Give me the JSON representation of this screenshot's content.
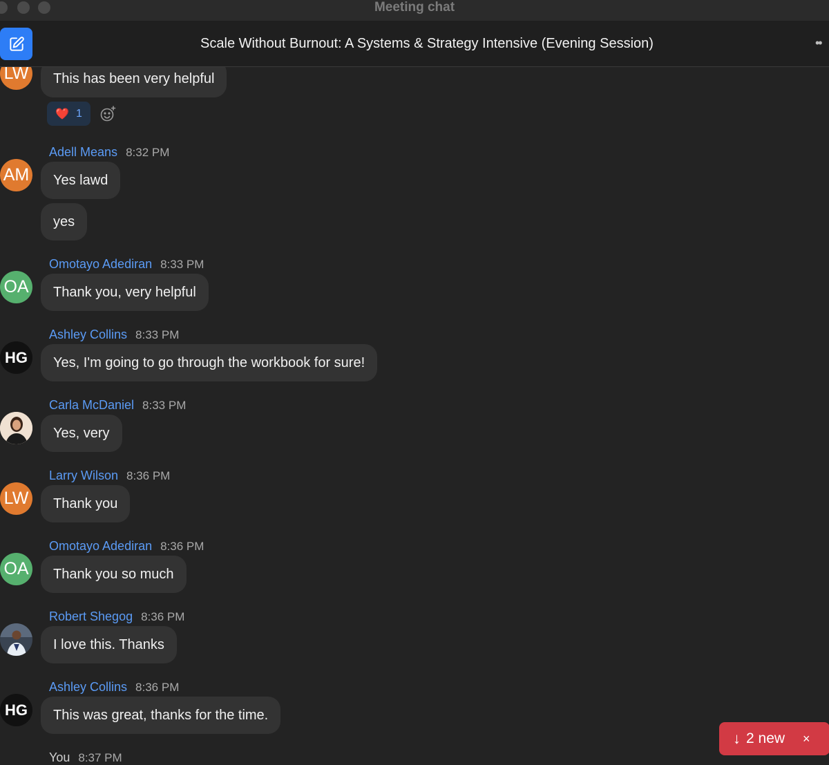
{
  "window": {
    "title": "Meeting chat"
  },
  "header": {
    "title": "Scale Without Burnout: A Systems & Strategy Intensive (Evening Session)",
    "more_label": "••"
  },
  "first_message": {
    "avatar": "LW",
    "text": "This has been very helpful",
    "reaction": {
      "emoji": "❤️",
      "count": "1"
    }
  },
  "messages": [
    {
      "name": "Adell Means",
      "time": "8:32 PM",
      "avatar": "AM",
      "texts": [
        "Yes lawd",
        "yes"
      ]
    },
    {
      "name": "Omotayo Adediran",
      "time": "8:33 PM",
      "avatar": "OA",
      "texts": [
        "Thank you, very helpful"
      ]
    },
    {
      "name": "Ashley Collins",
      "time": "8:33 PM",
      "avatar": "HG",
      "texts": [
        "Yes, I'm going to go through the workbook for sure!"
      ]
    },
    {
      "name": "Carla McDaniel",
      "time": "8:33 PM",
      "avatar": "",
      "texts": [
        "Yes, very"
      ]
    },
    {
      "name": "Larry Wilson",
      "time": "8:36 PM",
      "avatar": "LW",
      "texts": [
        "Thank you"
      ]
    },
    {
      "name": "Omotayo Adediran",
      "time": "8:36 PM",
      "avatar": "OA",
      "texts": [
        "Thank you so much"
      ]
    },
    {
      "name": "Robert Shegog",
      "time": "8:36 PM",
      "avatar": "",
      "texts": [
        "I love this. Thanks"
      ]
    },
    {
      "name": "Ashley Collins",
      "time": "8:36 PM",
      "avatar": "HG",
      "texts": [
        "This was great, thanks for the time."
      ]
    },
    {
      "name": "You",
      "time": "8:37 PM"
    }
  ],
  "new_messages": {
    "label": "2 new",
    "arrow": "↓",
    "close": "×"
  },
  "colors": {
    "accent": "#2d7df6",
    "name": "#5b9bf5",
    "alert": "#d23a44",
    "bubble": "#333333",
    "avatar_orange": "#e07a2f",
    "avatar_green": "#56b06e"
  }
}
